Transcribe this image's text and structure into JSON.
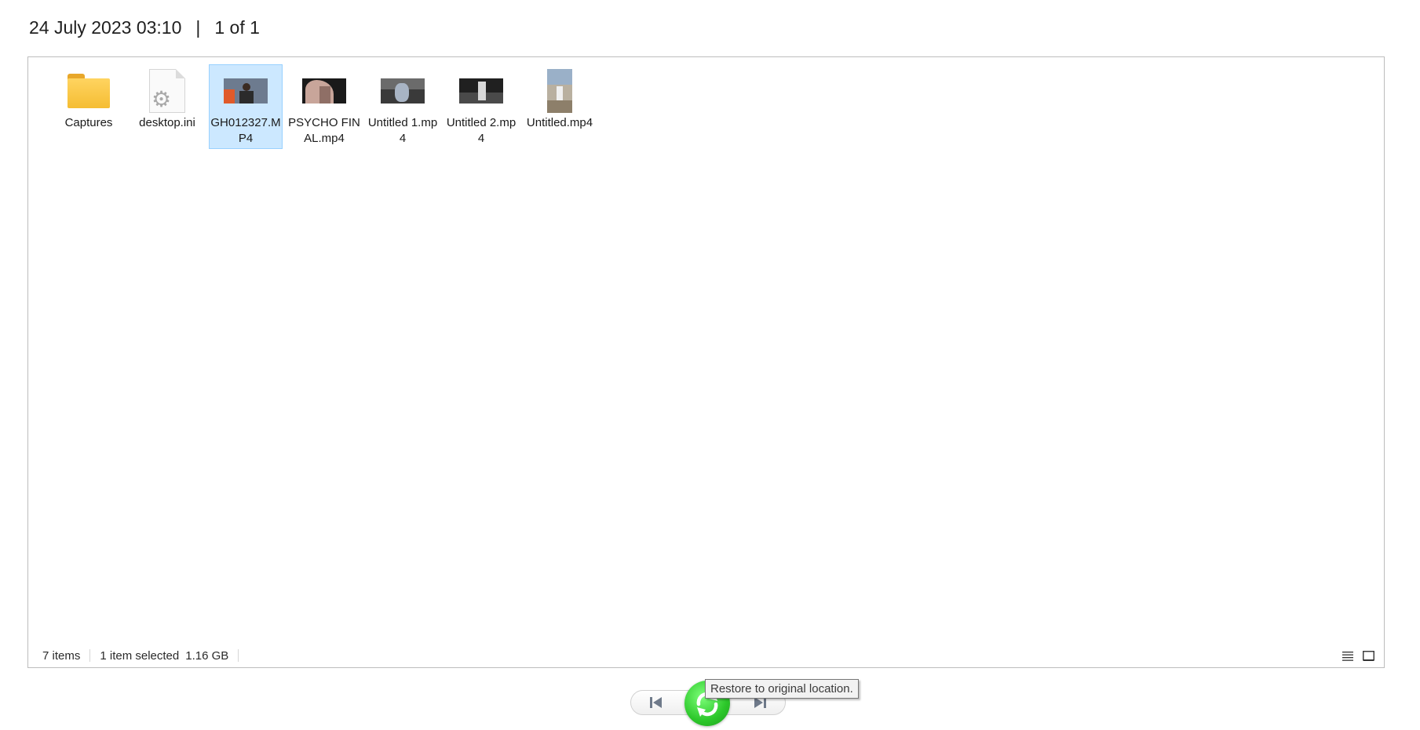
{
  "header": {
    "date": "24 July 2023 03:10",
    "separator": "|",
    "page_info": "1 of 1"
  },
  "files": [
    {
      "name": "Captures",
      "type": "folder-icon",
      "selected": false
    },
    {
      "name": "desktop.ini",
      "type": "settings-file-icon",
      "selected": false
    },
    {
      "name": "GH012327.MP4",
      "type": "video-thumbnail",
      "selected": true
    },
    {
      "name": "PSYCHO FINAL.mp4",
      "type": "video-thumbnail",
      "selected": false
    },
    {
      "name": "Untitled 1.mp4",
      "type": "video-thumbnail",
      "selected": false
    },
    {
      "name": "Untitled 2.mp4",
      "type": "video-thumbnail",
      "selected": false
    },
    {
      "name": "Untitled.mp4",
      "type": "video-thumbnail",
      "selected": false
    }
  ],
  "status": {
    "item_count": "7 items",
    "selected": "1 item selected",
    "size": "1.16 GB"
  },
  "nav": {
    "tooltip": "Restore to original location."
  },
  "colors": {
    "selection_bg": "#cce8ff",
    "selection_border": "#99d1ff",
    "restore_button": "#2cc72a"
  }
}
